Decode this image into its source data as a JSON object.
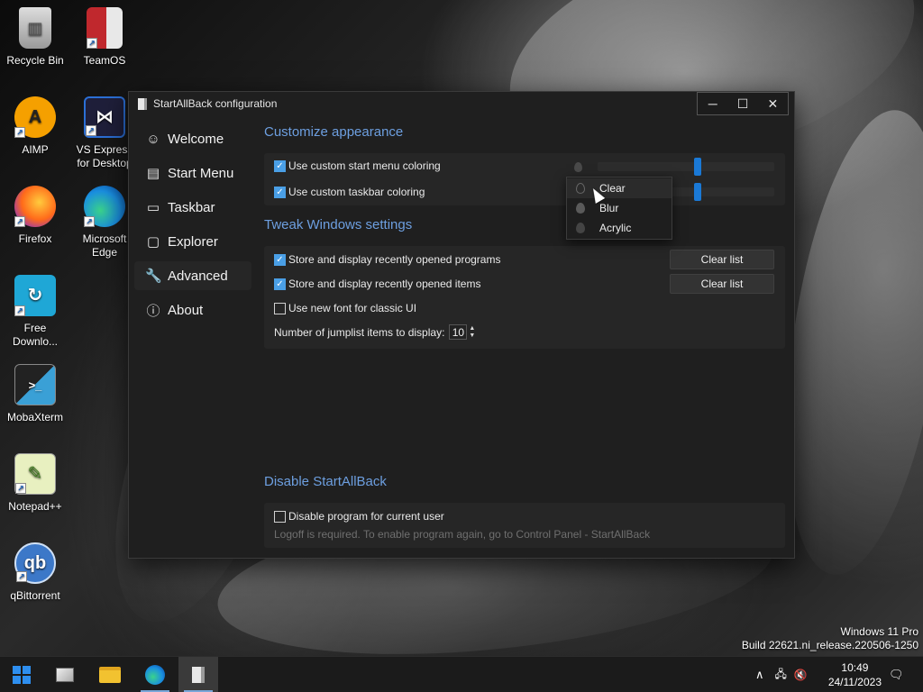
{
  "desktop": {
    "icons": [
      {
        "label": "Recycle Bin",
        "glyph": "🗑"
      },
      {
        "label": "TeamOS",
        "glyph": ""
      },
      {
        "label": "AIMP",
        "glyph": "A"
      },
      {
        "label": "VS Express for Desktop",
        "glyph": "⋈"
      },
      {
        "label": "Firefox",
        "glyph": ""
      },
      {
        "label": "Microsoft Edge",
        "glyph": ""
      },
      {
        "label": "Free Downlo...",
        "glyph": "↻"
      },
      {
        "label": "MobaXterm",
        "glyph": ">_"
      },
      {
        "label": "Notepad++",
        "glyph": "✎"
      },
      {
        "label": "qBittorrent",
        "glyph": "qb"
      }
    ]
  },
  "window": {
    "title": "StartAllBack configuration",
    "controls": {
      "minimize": "─",
      "maximize": "☐",
      "close": "✕"
    }
  },
  "sidebar": {
    "items": [
      {
        "label": "Welcome",
        "icon": "☺"
      },
      {
        "label": "Start Menu",
        "icon": "▤"
      },
      {
        "label": "Taskbar",
        "icon": "▭"
      },
      {
        "label": "Explorer",
        "icon": "▢"
      },
      {
        "label": "Advanced",
        "icon": "🔧"
      },
      {
        "label": "About",
        "icon": "ⓘ"
      }
    ],
    "active": "Advanced"
  },
  "sections": {
    "appearance": {
      "title": "Customize appearance",
      "start_menu_coloring": {
        "label": "Use custom start menu coloring",
        "checked": true
      },
      "taskbar_coloring": {
        "label": "Use custom taskbar coloring",
        "checked": true
      }
    },
    "tweak": {
      "title": "Tweak Windows settings",
      "recent_programs": {
        "label": "Store and display recently opened programs",
        "checked": true,
        "button": "Clear list"
      },
      "recent_items": {
        "label": "Store and display recently opened items",
        "checked": true,
        "button": "Clear list"
      },
      "new_font": {
        "label": "Use new font for classic UI",
        "checked": false
      },
      "jumplist": {
        "label": "Number of jumplist items to display:",
        "value": "10"
      }
    },
    "disable": {
      "title": "Disable StartAllBack",
      "disable_program": {
        "label": "Disable program for current user",
        "checked": false
      },
      "hint": "Logoff is required. To enable program again, go to Control Panel - StartAllBack"
    }
  },
  "dropdown": {
    "options": [
      "Clear",
      "Blur",
      "Acrylic"
    ],
    "hovered": "Clear"
  },
  "watermark": {
    "edition": "Windows 11 Pro",
    "build": "Build 22621.ni_release.220506-1250"
  },
  "taskbar": {
    "clock_time": "10:49",
    "clock_date": "24/11/2023",
    "tray": {
      "chevron": "∧",
      "network": "🖧",
      "volume": "🔇",
      "notification": "🗨"
    }
  },
  "colors": {
    "accent": "#4a9fe6",
    "section_title": "#6d9fe0",
    "slider_thumb": "#1a79d6"
  }
}
